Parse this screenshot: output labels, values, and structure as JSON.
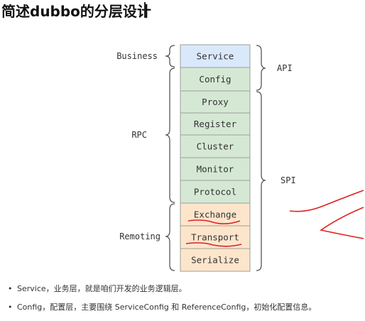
{
  "title": "简述dubbo的分层设计",
  "layers": [
    {
      "label": "Service",
      "group": "business"
    },
    {
      "label": "Config",
      "group": "rpc"
    },
    {
      "label": "Proxy",
      "group": "rpc"
    },
    {
      "label": "Register",
      "group": "rpc"
    },
    {
      "label": "Cluster",
      "group": "rpc"
    },
    {
      "label": "Monitor",
      "group": "rpc"
    },
    {
      "label": "Protocol",
      "group": "rpc"
    },
    {
      "label": "Exchange",
      "group": "remoting"
    },
    {
      "label": "Transport",
      "group": "remoting"
    },
    {
      "label": "Serialize",
      "group": "remoting"
    }
  ],
  "left_groups": {
    "business": "Business",
    "rpc": "RPC",
    "remoting": "Remoting"
  },
  "right_groups": {
    "api": "API",
    "spi": "SPI"
  },
  "colors": {
    "business": "#dae8fc",
    "rpc": "#d5e8d4",
    "remoting": "#fde5cc",
    "border": "#9aa19a",
    "annotation": "#e02020"
  },
  "bullets": [
    "Service，业务层，就是咱们开发的业务逻辑层。",
    "Config，配置层，主要围绕 ServiceConfig 和 ReferenceConfig，初始化配置信息。"
  ]
}
